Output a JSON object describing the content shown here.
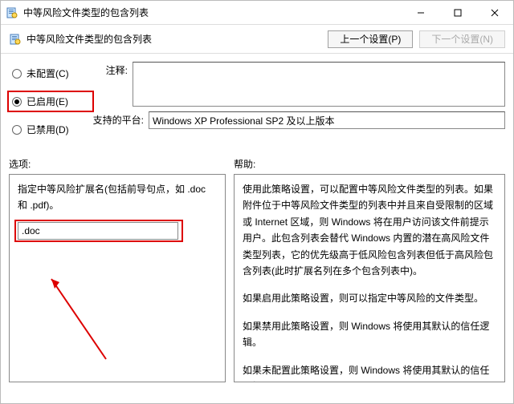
{
  "titlebar": {
    "title": "中等风险文件类型的包含列表"
  },
  "subheader": {
    "label": "中等风险文件类型的包含列表",
    "prev_btn": "上一个设置(P)",
    "next_btn": "下一个设置(N)"
  },
  "radios": {
    "not_configured": "未配置(C)",
    "enabled": "已启用(E)",
    "disabled": "已禁用(D)"
  },
  "config": {
    "comment_label": "注释:",
    "platform_label": "支持的平台:",
    "platform_value": "Windows XP Professional SP2 及以上版本"
  },
  "columns": {
    "options": "选项:",
    "help": "帮助:"
  },
  "options": {
    "desc": "指定中等风险扩展名(包括前导句点，如 .doc 和 .pdf)。",
    "input_value": ".doc"
  },
  "help": {
    "p1": "使用此策略设置，可以配置中等风险文件类型的列表。如果附件位于中等风险文件类型的列表中并且来自受限制的区域或 Internet 区域，则 Windows 将在用户访问该文件前提示用户。此包含列表会替代 Windows 内置的潜在高风险文件类型列表，它的优先级高于低风险包含列表但低于高风险包含列表(此时扩展名列在多个包含列表中)。",
    "p2": "如果启用此策略设置，则可以指定中等风险的文件类型。",
    "p3": "如果禁用此策略设置，则 Windows 将使用其默认的信任逻辑。",
    "p4": "如果未配置此策略设置，则 Windows 将使用其默认的信任逻辑。"
  }
}
